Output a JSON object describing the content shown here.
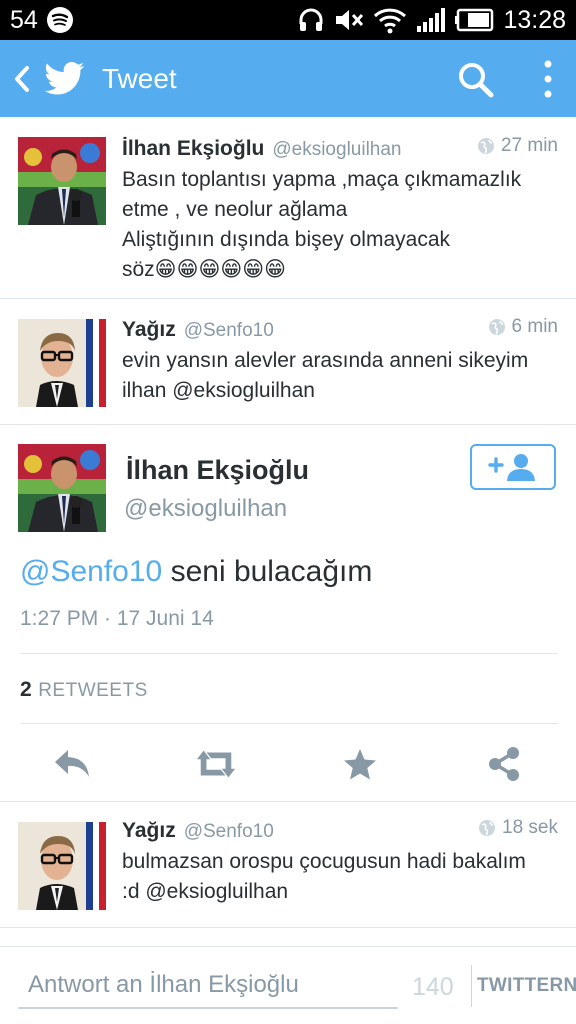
{
  "status_bar": {
    "notification_count": "54",
    "time": "13:28"
  },
  "app_bar": {
    "title": "Tweet"
  },
  "tweets_above": [
    {
      "name": "İlhan Ekşioğlu",
      "handle": "@eksiogluilhan",
      "time": "27 min",
      "text": "Basın toplantısı yapma ,maça çıkmamazlık\netme  , ve neolur ağlama\nAliştığının dışında bişey olmayacak\nsöz😁😁😁😁😁😁"
    },
    {
      "name": "Yağız",
      "handle": "@Senfo10",
      "time": "6 min",
      "text": "evin yansın alevler arasında anneni sikeyim\nilhan @eksiogluilhan"
    }
  ],
  "focused_tweet": {
    "name": "İlhan Ekşioğlu",
    "handle": "@eksiogluilhan",
    "mention": "@Senfo10",
    "text": " seni bulacağım",
    "timestamp": "1:27 PM · 17 Juni 14",
    "retweet_count": "2",
    "retweets_label": "RETWEETS"
  },
  "replies": [
    {
      "name": "Yağız",
      "handle": "@Senfo10",
      "time": "18 sek",
      "text": "bulmazsan orospu çocugusun hadi bakalım\n:d @eksiogluilhan"
    }
  ],
  "composer": {
    "placeholder": "Antwort an İlhan Ekşioğlu",
    "char_count": "140",
    "send_label": "TWITTERN"
  },
  "colors": {
    "brand": "#55acee",
    "text": "#292f33",
    "muted": "#8899a6",
    "divider": "#e1e8ed"
  }
}
